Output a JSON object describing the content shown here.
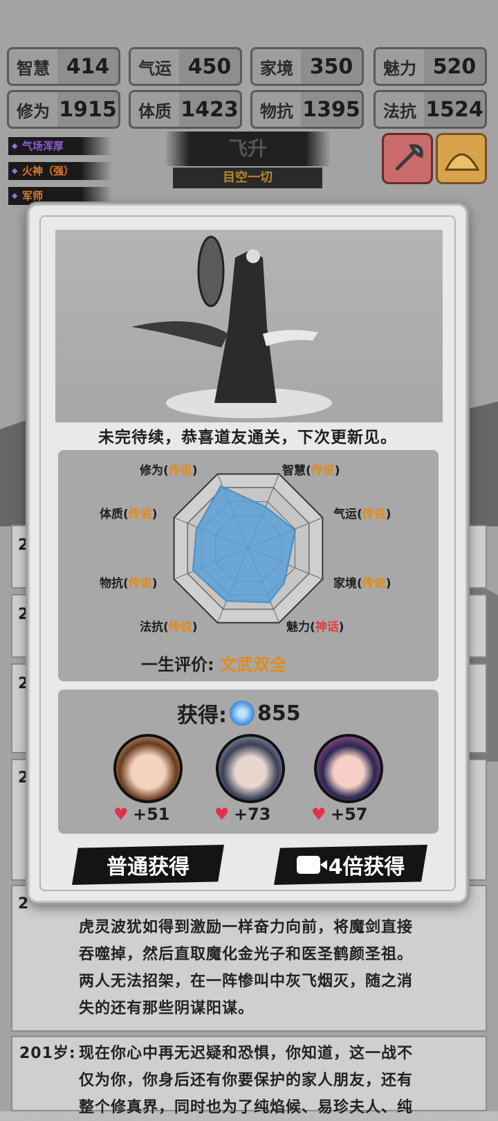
{
  "stats_row1": [
    {
      "label": "智慧",
      "value": "414"
    },
    {
      "label": "气运",
      "value": "450"
    },
    {
      "label": "家境",
      "value": "350"
    },
    {
      "label": "魅力",
      "value": "520"
    }
  ],
  "stats_row2": [
    {
      "label": "修为",
      "value": "1915"
    },
    {
      "label": "体质",
      "value": "1423"
    },
    {
      "label": "物抗",
      "value": "1395"
    },
    {
      "label": "法抗",
      "value": "1524"
    }
  ],
  "traits": [
    "气场浑厚",
    "火神（强）",
    "军师"
  ],
  "trait_colors": [
    "#8b5bd0",
    "#e07a2a",
    "#e07a2a"
  ],
  "title": {
    "main": "飞升",
    "sub": "目空一切"
  },
  "modal": {
    "congrats": "未完待续，恭喜道友通关，下次更新见。",
    "radar_labels": [
      {
        "name": "修为",
        "grade": "传说",
        "type": "g"
      },
      {
        "name": "智慧",
        "grade": "传说",
        "type": "g"
      },
      {
        "name": "气运",
        "grade": "传说",
        "type": "g"
      },
      {
        "name": "家境",
        "grade": "传说",
        "type": "g"
      },
      {
        "name": "魅力",
        "grade": "神话",
        "type": "m"
      },
      {
        "name": "法抗",
        "grade": "传说",
        "type": "g"
      },
      {
        "name": "物抗",
        "grade": "传说",
        "type": "g"
      },
      {
        "name": "体质",
        "grade": "传说",
        "type": "g"
      }
    ],
    "evaluation_label": "一生评价:",
    "evaluation_value": "文武双全",
    "reward_label": "获得:",
    "reward_amount": "855",
    "companions": [
      {
        "name": "companion-1",
        "affection": "+51"
      },
      {
        "name": "companion-2",
        "affection": "+73"
      },
      {
        "name": "companion-3",
        "affection": "+57"
      }
    ],
    "btn_normal": "普通获得",
    "btn_4x": "4倍获得"
  },
  "log_entries": {
    "entry1_lines": [
      "虎灵波犹如得到激励一样奋力向前，将魔剑直接",
      "吞噬掉，然后直取魔化金光子和医圣鹤颜圣祖。",
      "两人无法招架，在一阵惨叫中灰飞烟灭，随之消",
      "失的还有那些阴谋阳谋。"
    ],
    "entry2_age": "201岁:",
    "entry2_lines": [
      "现在你心中再无迟疑和恐惧，你知道，这一战不",
      "仅为你，你身后还有你要保护的家人朋友，还有",
      "整个修真界，同时也为了纯焰候、易珍夫人、纯"
    ],
    "age_prefixes": [
      "2",
      "2",
      "2",
      "2",
      "2"
    ]
  },
  "colors": {
    "legend": "#e28a1a",
    "myth": "#e43b3b",
    "radar_fill": "#5aa0d6"
  }
}
